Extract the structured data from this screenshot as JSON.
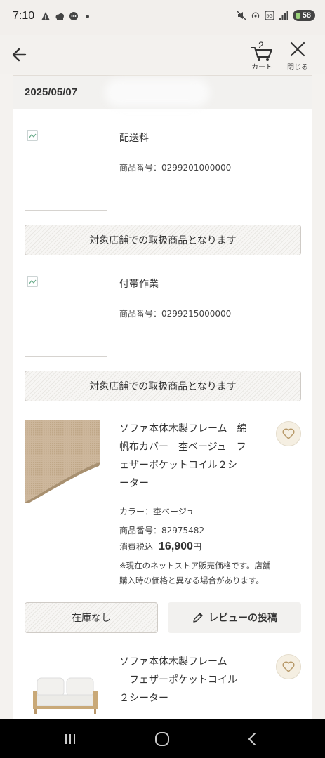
{
  "status_bar": {
    "time": "7:10",
    "battery": "58",
    "left_icons": [
      "warning-icon",
      "cloud-icon",
      "chat-icon",
      "dot-icon"
    ],
    "right_icons": [
      "mute-icon",
      "hotspot-icon",
      "5g-icon",
      "signal-icon"
    ]
  },
  "header": {
    "cart_count": "2",
    "cart_label": "カート",
    "close_label": "閉じる"
  },
  "order": {
    "date": "2025/05/07",
    "items": [
      {
        "name": "配送料",
        "product_no": "商品番号：0299201000000",
        "button": "対象店舗での取扱商品となります"
      },
      {
        "name": "付帯作業",
        "product_no": "商品番号：0299215000000",
        "button": "対象店舗での取扱商品となります"
      },
      {
        "name_lines": [
          "ソファ本体木製フレーム　綿",
          "帆布カバー　杢ベージュ　フ",
          "ェザーポケットコイル２シ",
          "ーター"
        ],
        "color": "カラー：杢ベージュ",
        "product_no": "商品番号：82975482",
        "price_label": "消費税込",
        "price": "16,900",
        "price_unit": "円",
        "note_lines": [
          "※現在のネットストア販売価格です。店舗",
          "購入時の価格と異なる場合があります。"
        ],
        "stock_button": "在庫なし",
        "review_button": "レビューの投稿"
      },
      {
        "name_lines": [
          "ソファ本体木製フレーム",
          "　フェザーポケットコイル",
          "２シーター"
        ]
      }
    ]
  },
  "colors": {
    "accent_fav": "#f5efe2",
    "background": "#f4f2ef"
  }
}
